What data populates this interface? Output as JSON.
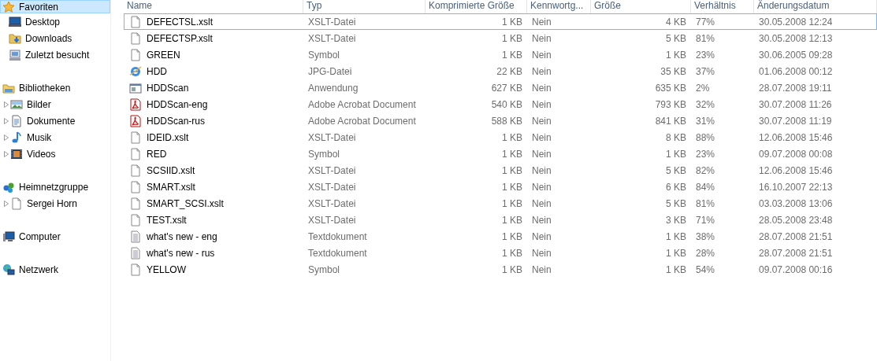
{
  "sidebar": {
    "items": [
      {
        "kind": "star",
        "label": "Favoriten",
        "selected": true,
        "children": [
          {
            "kind": "desktop",
            "label": "Desktop",
            "selected": false
          },
          {
            "kind": "downloads",
            "label": "Downloads",
            "selected": false
          },
          {
            "kind": "recent",
            "label": "Zuletzt besucht",
            "selected": false
          }
        ]
      },
      {
        "kind": "library",
        "label": "Bibliotheken",
        "selected": false,
        "children": [
          {
            "kind": "pictures",
            "label": "Bilder",
            "selected": false,
            "expanded": false
          },
          {
            "kind": "documents",
            "label": "Dokumente",
            "selected": false,
            "expanded": false
          },
          {
            "kind": "music",
            "label": "Musik",
            "selected": false,
            "expanded": false
          },
          {
            "kind": "videos",
            "label": "Videos",
            "selected": false,
            "expanded": false
          }
        ]
      },
      {
        "kind": "homegroup",
        "label": "Heimnetzgruppe",
        "selected": false,
        "children": [
          {
            "kind": "file",
            "label": "Sergei Horn",
            "selected": false,
            "expanded": false
          }
        ]
      },
      {
        "kind": "computer",
        "label": "Computer",
        "selected": false
      },
      {
        "kind": "network",
        "label": "Netzwerk",
        "selected": false
      }
    ]
  },
  "table": {
    "columns": [
      "Name",
      "Typ",
      "Komprimierte Größe",
      "Kennwortg...",
      "Größe",
      "Verhältnis",
      "Änderungsdatum"
    ],
    "rows": [
      {
        "kind": "file",
        "name": "DEFECTSL.xslt",
        "type": "XSLT-Datei",
        "compressed_size": "1 KB",
        "password": "Nein",
        "size": "4 KB",
        "ratio": "77%",
        "modified": "30.05.2008 12:24",
        "selected": true
      },
      {
        "kind": "file",
        "name": "DEFECTSP.xslt",
        "type": "XSLT-Datei",
        "compressed_size": "1 KB",
        "password": "Nein",
        "size": "5 KB",
        "ratio": "81%",
        "modified": "30.05.2008 12:13",
        "selected": false
      },
      {
        "kind": "file",
        "name": "GREEN",
        "type": "Symbol",
        "compressed_size": "1 KB",
        "password": "Nein",
        "size": "1 KB",
        "ratio": "23%",
        "modified": "30.06.2005 09:28",
        "selected": false
      },
      {
        "kind": "web",
        "name": "HDD",
        "type": "JPG-Datei",
        "compressed_size": "22 KB",
        "password": "Nein",
        "size": "35 KB",
        "ratio": "37%",
        "modified": "01.06.2008 00:12",
        "selected": false
      },
      {
        "kind": "app",
        "name": "HDDScan",
        "type": "Anwendung",
        "compressed_size": "627 KB",
        "password": "Nein",
        "size": "635 KB",
        "ratio": "2%",
        "modified": "28.07.2008 19:11",
        "selected": false
      },
      {
        "kind": "pdf",
        "name": "HDDScan-eng",
        "type": "Adobe Acrobat Document",
        "compressed_size": "540 KB",
        "password": "Nein",
        "size": "793 KB",
        "ratio": "32%",
        "modified": "30.07.2008 11:26",
        "selected": false
      },
      {
        "kind": "pdf",
        "name": "HDDScan-rus",
        "type": "Adobe Acrobat Document",
        "compressed_size": "588 KB",
        "password": "Nein",
        "size": "841 KB",
        "ratio": "31%",
        "modified": "30.07.2008 11:19",
        "selected": false
      },
      {
        "kind": "file",
        "name": "IDEID.xslt",
        "type": "XSLT-Datei",
        "compressed_size": "1 KB",
        "password": "Nein",
        "size": "8 KB",
        "ratio": "88%",
        "modified": "12.06.2008 15:46",
        "selected": false
      },
      {
        "kind": "file",
        "name": "RED",
        "type": "Symbol",
        "compressed_size": "1 KB",
        "password": "Nein",
        "size": "1 KB",
        "ratio": "23%",
        "modified": "09.07.2008 00:08",
        "selected": false
      },
      {
        "kind": "file",
        "name": "SCSIID.xslt",
        "type": "XSLT-Datei",
        "compressed_size": "1 KB",
        "password": "Nein",
        "size": "5 KB",
        "ratio": "82%",
        "modified": "12.06.2008 15:46",
        "selected": false
      },
      {
        "kind": "file",
        "name": "SMART.xslt",
        "type": "XSLT-Datei",
        "compressed_size": "1 KB",
        "password": "Nein",
        "size": "6 KB",
        "ratio": "84%",
        "modified": "16.10.2007 22:13",
        "selected": false
      },
      {
        "kind": "file",
        "name": "SMART_SCSI.xslt",
        "type": "XSLT-Datei",
        "compressed_size": "1 KB",
        "password": "Nein",
        "size": "5 KB",
        "ratio": "81%",
        "modified": "03.03.2008 13:06",
        "selected": false
      },
      {
        "kind": "file",
        "name": "TEST.xslt",
        "type": "XSLT-Datei",
        "compressed_size": "1 KB",
        "password": "Nein",
        "size": "3 KB",
        "ratio": "71%",
        "modified": "28.05.2008 23:48",
        "selected": false
      },
      {
        "kind": "text",
        "name": "what's new - eng",
        "type": "Textdokument",
        "compressed_size": "1 KB",
        "password": "Nein",
        "size": "1 KB",
        "ratio": "38%",
        "modified": "28.07.2008 21:51",
        "selected": false
      },
      {
        "kind": "text",
        "name": "what's new - rus",
        "type": "Textdokument",
        "compressed_size": "1 KB",
        "password": "Nein",
        "size": "1 KB",
        "ratio": "28%",
        "modified": "28.07.2008 21:51",
        "selected": false
      },
      {
        "kind": "file",
        "name": "YELLOW",
        "type": "Symbol",
        "compressed_size": "1 KB",
        "password": "Nein",
        "size": "1 KB",
        "ratio": "54%",
        "modified": "09.07.2008 00:16",
        "selected": false
      }
    ]
  }
}
